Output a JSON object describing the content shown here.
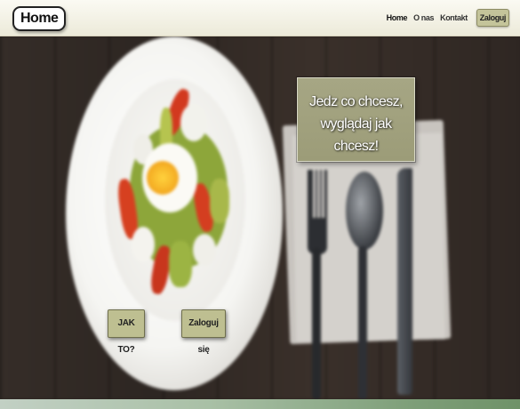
{
  "nav": {
    "home_label": "Home",
    "links": [
      "Home",
      "O nas",
      "Kontakt"
    ],
    "login_label": "Zaloguj"
  },
  "hero": {
    "slogan_line1": "Jedz co chcesz,",
    "slogan_line2": "wyglądaj jak chcesz!",
    "how_label": "JAK TO?",
    "login_label": "Zaloguj się",
    "image": "blurred plate of salad with egg, fork, spoon and knife on napkin, dark wood table"
  },
  "colors": {
    "accent": "#bebf91",
    "nav_bg": "#f5f3e7",
    "footer": "#7d9e78"
  }
}
